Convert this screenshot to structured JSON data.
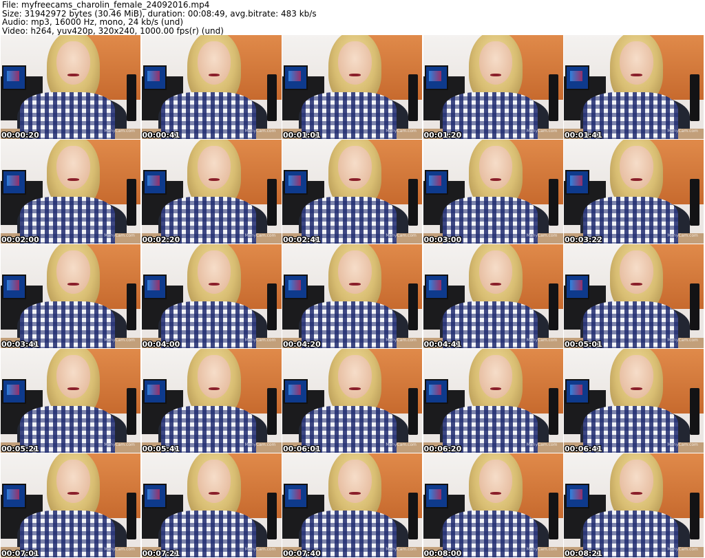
{
  "header": {
    "file": "File: myfreecams_charolin_female_24092016.mp4",
    "size": "Size: 31942972 bytes (30.46 MiB), duration: 00:08:49, avg.bitrate: 483 kb/s",
    "audio": "Audio: mp3, 16000 Hz, mono, 24 kb/s (und)",
    "video": "Video: h264, yuv420p, 320x240, 1000.00 fps(r) (und)"
  },
  "watermark": "ManyCam.com",
  "thumbnails": [
    {
      "timestamp": "00:00:20"
    },
    {
      "timestamp": "00:00:41"
    },
    {
      "timestamp": "00:01:01"
    },
    {
      "timestamp": "00:01:20"
    },
    {
      "timestamp": "00:01:41"
    },
    {
      "timestamp": "00:02:00"
    },
    {
      "timestamp": "00:02:20"
    },
    {
      "timestamp": "00:02:41"
    },
    {
      "timestamp": "00:03:00"
    },
    {
      "timestamp": "00:03:22"
    },
    {
      "timestamp": "00:03:41"
    },
    {
      "timestamp": "00:04:00"
    },
    {
      "timestamp": "00:04:20"
    },
    {
      "timestamp": "00:04:41"
    },
    {
      "timestamp": "00:05:01"
    },
    {
      "timestamp": "00:05:21"
    },
    {
      "timestamp": "00:05:41"
    },
    {
      "timestamp": "00:06:01"
    },
    {
      "timestamp": "00:06:20"
    },
    {
      "timestamp": "00:06:41"
    },
    {
      "timestamp": "00:07:01"
    },
    {
      "timestamp": "00:07:21"
    },
    {
      "timestamp": "00:07:40"
    },
    {
      "timestamp": "00:08:00"
    },
    {
      "timestamp": "00:08:21"
    }
  ]
}
